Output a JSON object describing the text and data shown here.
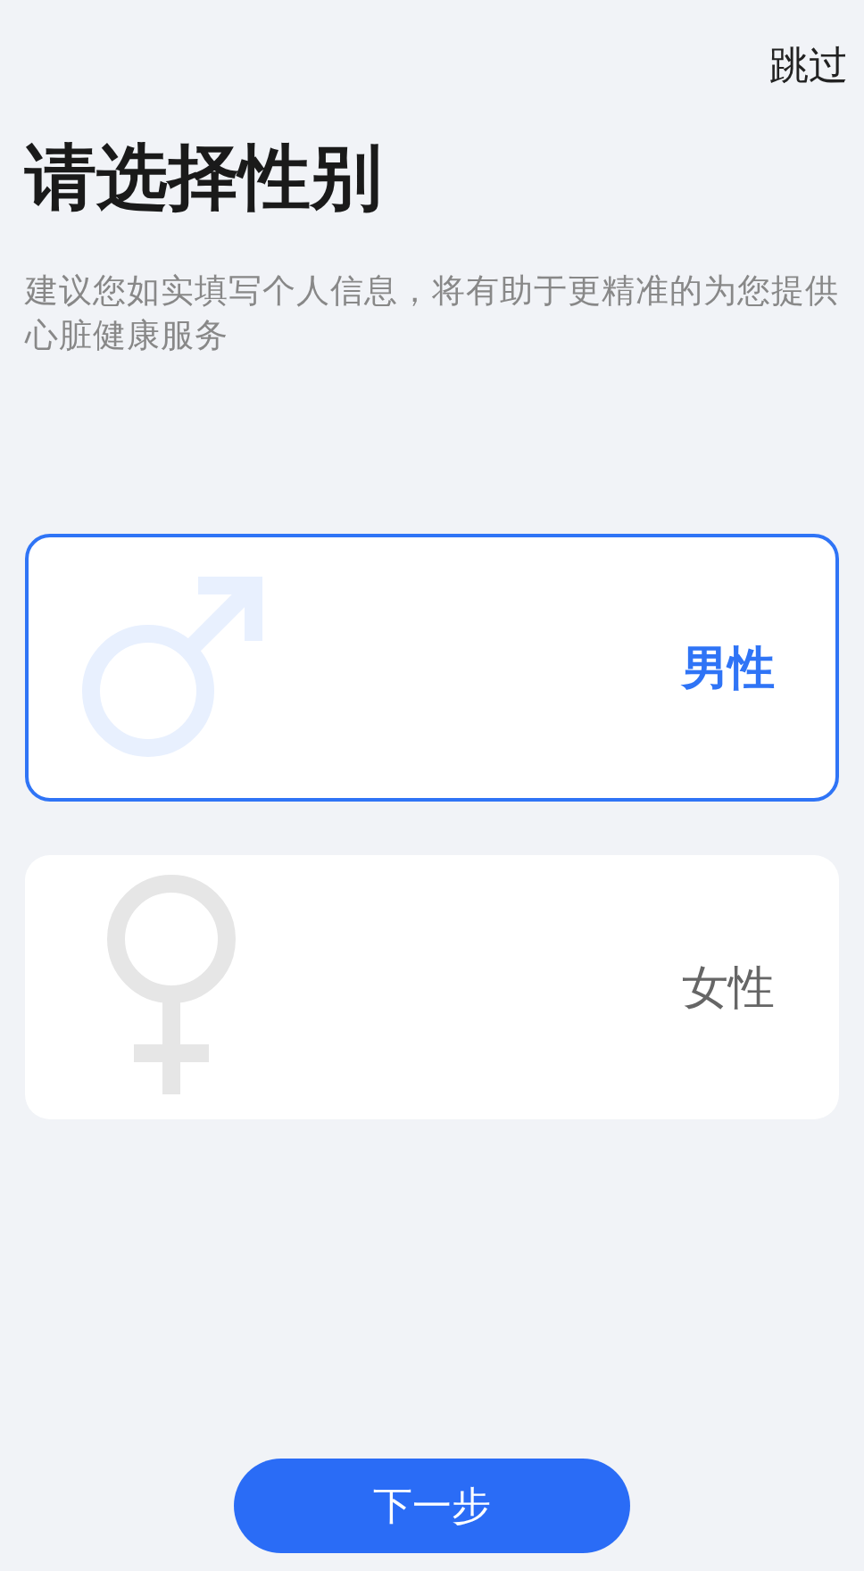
{
  "skip_button": "跳过",
  "title": "请选择性别",
  "subtitle": "建议您如实填写个人信息，将有助于更精准的为您提供心脏健康服务",
  "options": [
    {
      "kind": "male",
      "label": "男性",
      "selected": true
    },
    {
      "kind": "female",
      "label": "女性",
      "selected": false
    }
  ],
  "next_button": "下一步"
}
